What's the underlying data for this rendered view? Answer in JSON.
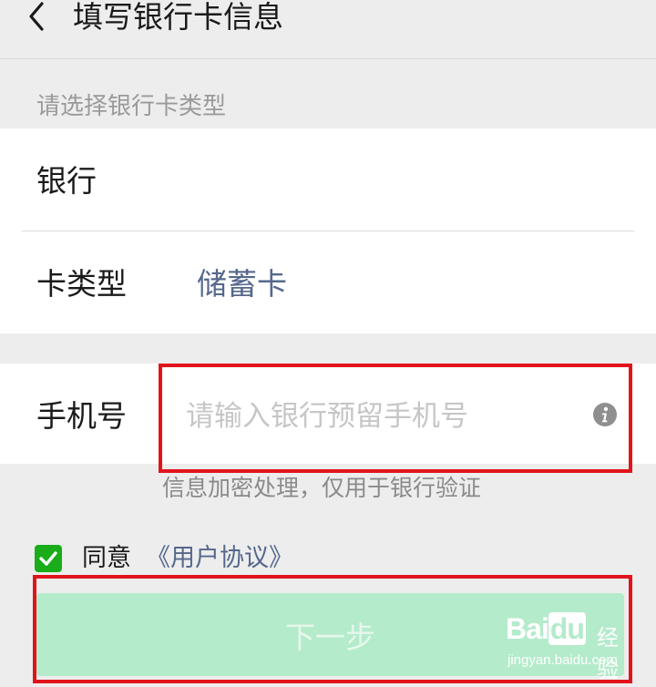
{
  "header": {
    "title": "填写银行卡信息",
    "back_icon": "chevron-left-icon"
  },
  "section": {
    "label": "请选择银行卡类型"
  },
  "bank_row": {
    "label": "银行",
    "value": ""
  },
  "card_type_row": {
    "label": "卡类型",
    "value": "储蓄卡"
  },
  "phone": {
    "label": "手机号",
    "value": "",
    "placeholder": "请输入银行预留手机号",
    "info_icon": "info-icon"
  },
  "hint": "信息加密处理，仅用于银行验证",
  "agreement": {
    "checked": true,
    "text": "同意",
    "link": "《用户协议》"
  },
  "next_button": {
    "label": "下一步"
  },
  "watermark": {
    "logo": "Bai",
    "logo_cn": "经验",
    "sub": "jingyan.baidu.com"
  },
  "colors": {
    "background": "#ededed",
    "link": "#55688c",
    "button_disabled": "#b4ebcb",
    "checkbox": "#1aad19",
    "highlight_box": "#e1141b"
  }
}
